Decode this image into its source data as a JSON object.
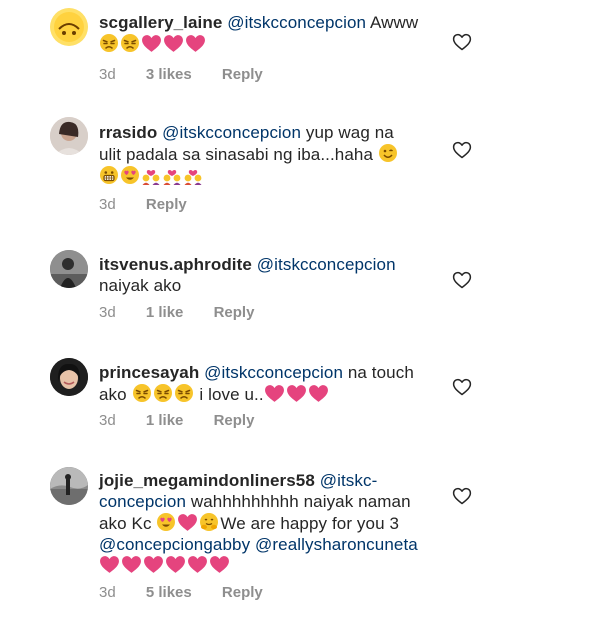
{
  "comments": [
    {
      "username": "scgallery_laine",
      "avatar": "gallery-logo",
      "mention": "@itskcconcepcion",
      "text": " Awww",
      "emoji_line": [
        "pouting-face",
        "pouting-face",
        "pink-heart",
        "pink-heart",
        "pink-heart"
      ],
      "age": "3d",
      "likes": "3 likes",
      "reply": "Reply"
    },
    {
      "username": "rrasido",
      "avatar": "profile-photo",
      "mention": "@itskcconcepcion",
      "text_l1": " yup wag na",
      "text_l2": "ulit padala sa sinasabi ng iba...haha",
      "emoji_line": [
        "grinning-face",
        "heart-eyes-face",
        "couple-with-heart",
        "couple-with-heart",
        "couple-with-heart"
      ],
      "age": "3d",
      "reply": "Reply"
    },
    {
      "username": "itsvenus.aphrodite",
      "avatar": "profile-photo",
      "mention": "@itskcconcepcion",
      "text_l2": "naiyak ako",
      "age": "3d",
      "likes": "1 like",
      "reply": "Reply"
    },
    {
      "username": "princesayah",
      "avatar": "profile-photo",
      "mention": "@itskcconcepcion",
      "text_l1": " na touch",
      "text_l2a": "ako ",
      "text_l2b": " i love u..",
      "age": "3d",
      "likes": "1 like",
      "reply": "Reply"
    },
    {
      "username": "jojie_megamindonliners58",
      "avatar": "profile-photo",
      "mention_a": "@itskc-",
      "mention_b": "concepcion",
      "text_l2": " wahhhhhhhhh naiyak naman",
      "text_l3a": "ako Kc ",
      "text_l3b": "We are happy for you 3",
      "mention_c": "@concepciongabby",
      "mention_d": "@reallysharoncuneta",
      "age": "3d",
      "likes": "5 likes",
      "reply": "Reply"
    }
  ],
  "colors": {
    "text": "#262626",
    "mention": "#003569",
    "meta": "#8e8e8e",
    "emoji_heart": "#e5447e",
    "emoji_face": "#f7c42a"
  },
  "icons": {
    "like": "heart-outline-icon"
  }
}
